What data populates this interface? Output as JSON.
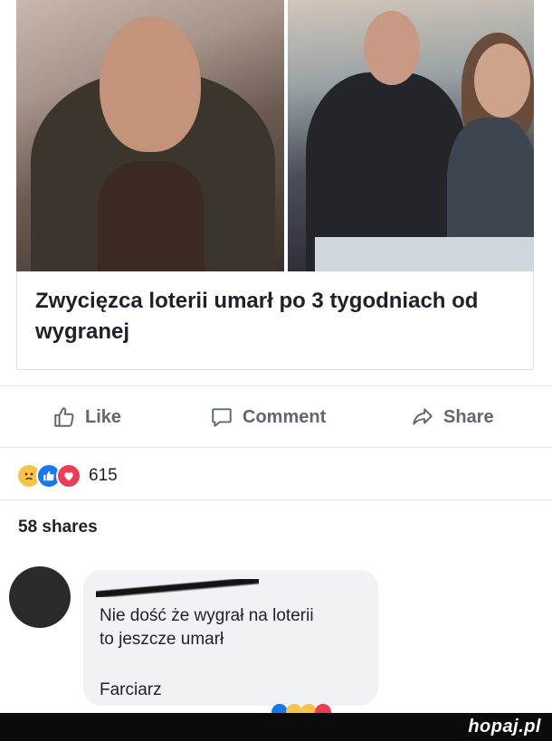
{
  "post": {
    "headline": "Zwycięzca loterii umarł po 3 tygodniach od wygranej",
    "actions": {
      "like": "Like",
      "comment": "Comment",
      "share": "Share"
    },
    "reactions": {
      "icons": [
        "sad-reaction-icon",
        "like-reaction-icon",
        "love-reaction-icon"
      ],
      "count": "615"
    },
    "shares": "58 shares"
  },
  "comment": {
    "lines": [
      "Nie dość że wygrał na loterii",
      "to jeszcze umarł",
      "Farciarz"
    ]
  },
  "watermark": {
    "logo": "hopaj.pl"
  },
  "colors": {
    "text": "#1d2129",
    "muted": "#606770",
    "like_blue": "#1877f2",
    "love_red": "#ee3b54",
    "sad_yellow": "#f7c34a",
    "bubble_bg": "#f0f2f5",
    "footer_bg": "#0b0b0b"
  }
}
